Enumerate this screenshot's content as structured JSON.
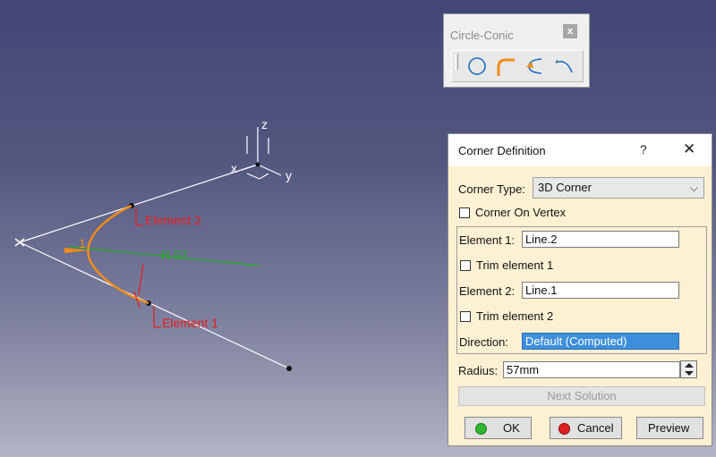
{
  "viewport": {
    "axis_x": "x",
    "axis_y": "y",
    "axis_z": "z",
    "element2_label": "Element 2",
    "element1_label": "Element 1",
    "radius_label": "R 57",
    "corner_index": "1",
    "colors": {
      "curve": "#f08c1a",
      "annotation": "#e81e1e",
      "radius": "#1fb01f",
      "lines": "#ffffff"
    }
  },
  "toolbar": {
    "title": "Circle-Conic",
    "close": "x",
    "icons": [
      "circle-icon",
      "corner-icon",
      "connect-curve-icon",
      "conic-icon"
    ]
  },
  "dialog": {
    "title": "Corner Definition",
    "help": "?",
    "close": "✕",
    "corner_type_label": "Corner Type:",
    "corner_type_value": "3D Corner",
    "corner_on_vertex_label": "Corner On Vertex",
    "element1_label": "Element 1:",
    "element1_value": "Line.2",
    "trim1_label": "Trim element 1",
    "element2_label": "Element 2:",
    "element2_value": "Line.1",
    "trim2_label": "Trim element 2",
    "direction_label": "Direction:",
    "direction_value": "Default (Computed)",
    "radius_label": "Radius:",
    "radius_value": "57mm",
    "next_solution": "Next Solution",
    "ok": "OK",
    "cancel": "Cancel",
    "preview": "Preview",
    "colors": {
      "background": "#fdf1d3",
      "selected": "#3d8fdc",
      "ok_dot": "#2fb52f",
      "cancel_dot": "#e02020"
    }
  }
}
